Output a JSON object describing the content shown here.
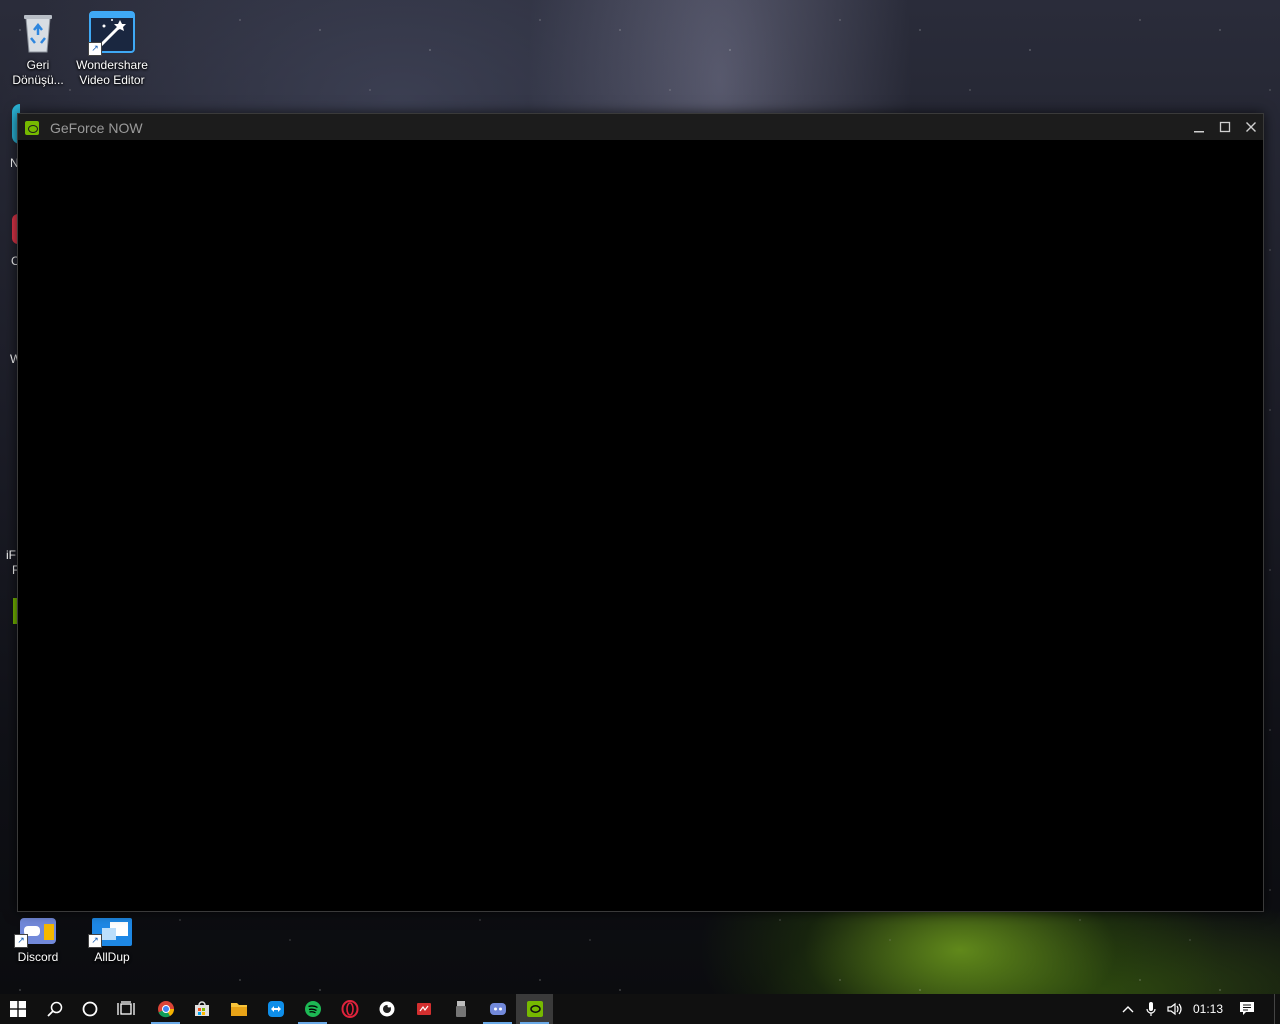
{
  "desktop": {
    "icons": [
      {
        "label_line1": "Geri",
        "label_line2": "Dönüşü...",
        "icon": "recycle-bin-icon"
      },
      {
        "label_line1": "Wondershare",
        "label_line2": "Video Editor",
        "icon": "wondershare-video-editor-icon"
      },
      {
        "label": "Discord",
        "icon": "discord-icon"
      },
      {
        "label": "AllDup",
        "icon": "alldup-icon"
      }
    ],
    "partial_labels": [
      "N",
      "C",
      "W",
      "iF",
      "F"
    ]
  },
  "window": {
    "title": "GeForce NOW",
    "icon": "geforce-now-icon",
    "accent": "#76b900"
  },
  "taskbar": {
    "apps": [
      {
        "name": "chrome",
        "icon": "chrome-icon"
      },
      {
        "name": "store",
        "icon": "store-icon"
      },
      {
        "name": "file-explorer",
        "icon": "folder-icon"
      },
      {
        "name": "teamviewer",
        "icon": "teamviewer-icon"
      },
      {
        "name": "spotify",
        "icon": "spotify-icon"
      },
      {
        "name": "opera",
        "icon": "opera-icon"
      },
      {
        "name": "app-circle",
        "icon": "circle-app-icon"
      },
      {
        "name": "red-app",
        "icon": "red-app-icon"
      },
      {
        "name": "usb-app",
        "icon": "usb-icon"
      },
      {
        "name": "discord",
        "icon": "discord-icon"
      },
      {
        "name": "geforce-now",
        "icon": "geforce-now-icon"
      }
    ],
    "clock": "01:13"
  }
}
